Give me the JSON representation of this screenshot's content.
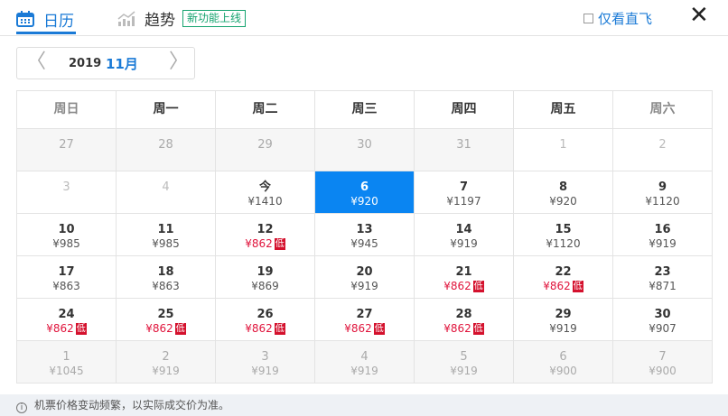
{
  "tabs": {
    "calendar": "日历",
    "trend": "趋势",
    "new_tag": "新功能上线"
  },
  "direct_only": {
    "label": "仅看直飞",
    "checked": false
  },
  "nav": {
    "year": "2019",
    "month": "11月"
  },
  "weekdays": [
    "周日",
    "周一",
    "周二",
    "周三",
    "周四",
    "周五",
    "周六"
  ],
  "low_label": "低",
  "days": [
    {
      "d": "27",
      "p": "",
      "t": "oth"
    },
    {
      "d": "28",
      "p": "",
      "t": "oth"
    },
    {
      "d": "29",
      "p": "",
      "t": "oth"
    },
    {
      "d": "30",
      "p": "",
      "t": "oth"
    },
    {
      "d": "31",
      "p": "",
      "t": "oth"
    },
    {
      "d": "1",
      "p": "",
      "t": "dim"
    },
    {
      "d": "2",
      "p": "",
      "t": "dim"
    },
    {
      "d": "3",
      "p": "",
      "t": "dim"
    },
    {
      "d": "4",
      "p": "",
      "t": "dim"
    },
    {
      "d": "今",
      "p": "¥1410",
      "t": ""
    },
    {
      "d": "6",
      "p": "¥920",
      "t": "sel"
    },
    {
      "d": "7",
      "p": "¥1197",
      "t": ""
    },
    {
      "d": "8",
      "p": "¥920",
      "t": ""
    },
    {
      "d": "9",
      "p": "¥1120",
      "t": ""
    },
    {
      "d": "10",
      "p": "¥985",
      "t": ""
    },
    {
      "d": "11",
      "p": "¥985",
      "t": ""
    },
    {
      "d": "12",
      "p": "¥862",
      "t": "low"
    },
    {
      "d": "13",
      "p": "¥945",
      "t": ""
    },
    {
      "d": "14",
      "p": "¥919",
      "t": ""
    },
    {
      "d": "15",
      "p": "¥1120",
      "t": ""
    },
    {
      "d": "16",
      "p": "¥919",
      "t": ""
    },
    {
      "d": "17",
      "p": "¥863",
      "t": ""
    },
    {
      "d": "18",
      "p": "¥863",
      "t": ""
    },
    {
      "d": "19",
      "p": "¥869",
      "t": ""
    },
    {
      "d": "20",
      "p": "¥919",
      "t": ""
    },
    {
      "d": "21",
      "p": "¥862",
      "t": "low"
    },
    {
      "d": "22",
      "p": "¥862",
      "t": "low"
    },
    {
      "d": "23",
      "p": "¥871",
      "t": ""
    },
    {
      "d": "24",
      "p": "¥862",
      "t": "low"
    },
    {
      "d": "25",
      "p": "¥862",
      "t": "low"
    },
    {
      "d": "26",
      "p": "¥862",
      "t": "low"
    },
    {
      "d": "27",
      "p": "¥862",
      "t": "low"
    },
    {
      "d": "28",
      "p": "¥862",
      "t": "low"
    },
    {
      "d": "29",
      "p": "¥919",
      "t": ""
    },
    {
      "d": "30",
      "p": "¥907",
      "t": ""
    },
    {
      "d": "1",
      "p": "¥1045",
      "t": "oth"
    },
    {
      "d": "2",
      "p": "¥919",
      "t": "oth"
    },
    {
      "d": "3",
      "p": "¥919",
      "t": "oth"
    },
    {
      "d": "4",
      "p": "¥919",
      "t": "oth"
    },
    {
      "d": "5",
      "p": "¥919",
      "t": "oth"
    },
    {
      "d": "6",
      "p": "¥900",
      "t": "oth"
    },
    {
      "d": "7",
      "p": "¥900",
      "t": "oth"
    }
  ],
  "footer": "机票价格变动频繁，以实际成交价为准。"
}
